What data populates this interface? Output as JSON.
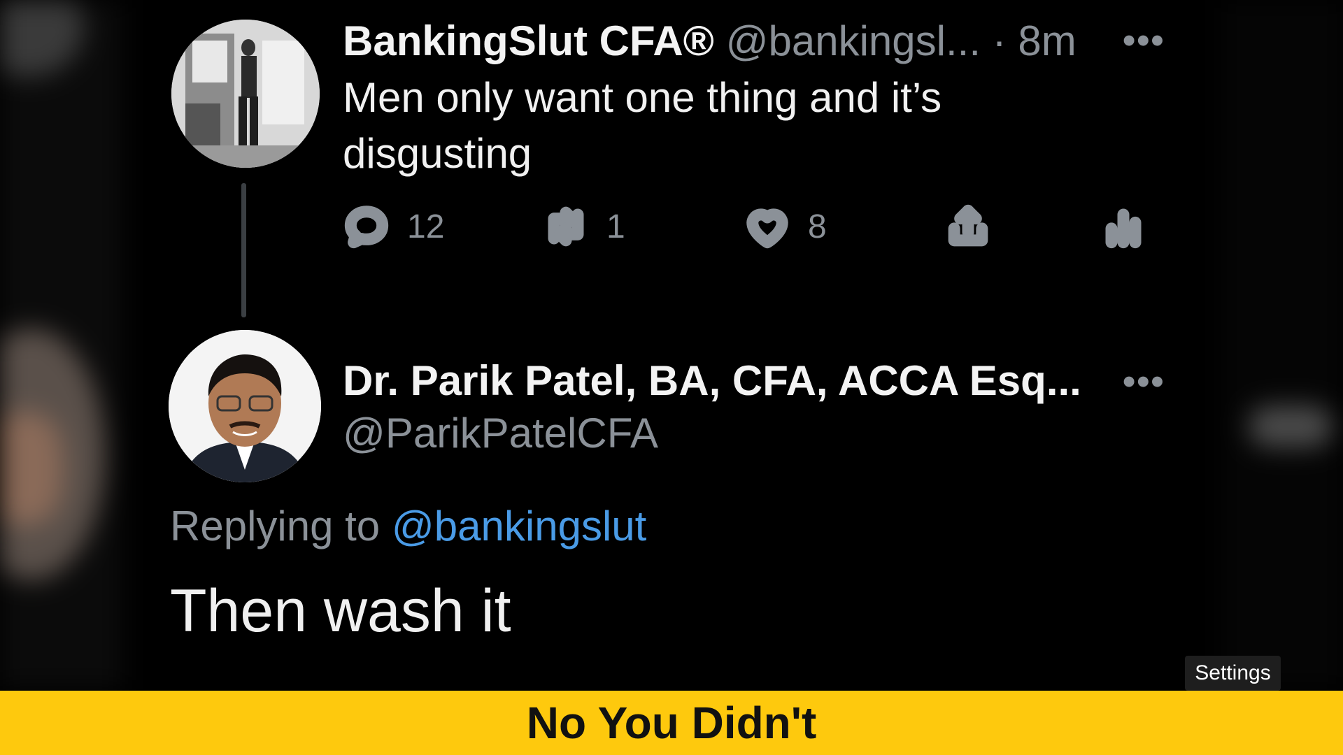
{
  "tweet1": {
    "display_name": "BankingSlut CFA®",
    "handle": "@bankingsl...",
    "separator": "·",
    "time": "8m",
    "text_line1": "Men only want one thing and it’s",
    "text_line2": "disgusting",
    "more": "•••",
    "actions": {
      "reply_icon": "comment-bubble-icon",
      "reply_count": "12",
      "retweet_icon": "retweet-icon",
      "retweet_count": "1",
      "like_icon": "heart-icon",
      "like_count": "8",
      "share_icon": "share-icon",
      "analytics_icon": "analytics-bars-icon"
    }
  },
  "tweet2": {
    "display_name": "Dr. Parik Patel, BA, CFA, ACCA Esq...",
    "handle": "@ParikPatelCFA",
    "more": "•••",
    "replying_to_label": "Replying to",
    "replying_to_handle": "@bankingslut",
    "text": "Then wash it"
  },
  "player": {
    "settings_label": "Settings"
  },
  "caption": {
    "text": "No You Didn't"
  },
  "colors": {
    "background": "#000000",
    "banner": "#fec90d",
    "mention": "#4a9be6",
    "muted": "#8b9198"
  }
}
